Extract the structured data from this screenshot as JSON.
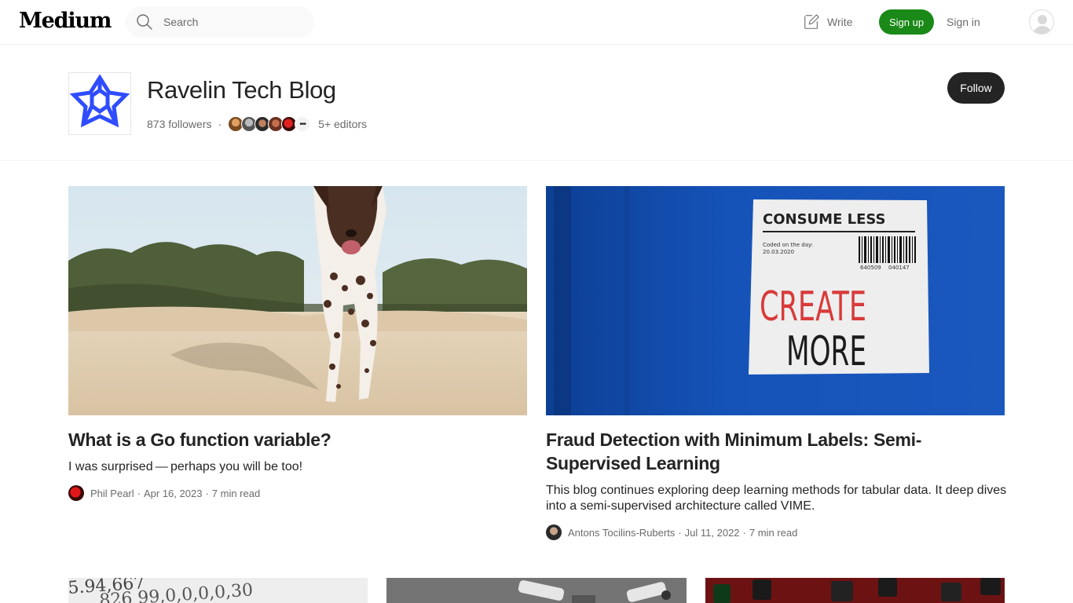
{
  "nav": {
    "logo": "Medium",
    "search_placeholder": "Search",
    "write_label": "Write",
    "signup_label": "Sign up",
    "signin_label": "Sign in"
  },
  "publication": {
    "name": "Ravelin Tech Blog",
    "followers": "873 followers",
    "editors": "5+ editors",
    "follow_label": "Follow"
  },
  "featured": [
    {
      "title": "What is a Go function variable?",
      "subtitle": "I was surprised — perhaps you will be too!",
      "author": "Phil Pearl",
      "date": "Apr 16, 2023",
      "read_time": "7 min read"
    },
    {
      "title": "Fraud Detection with Minimum Labels: Semi-Supervised Learning",
      "subtitle": "This blog continues exploring deep learning methods for tabular data. It deep dives into a semi-supervised architecture called VIME.",
      "author": "Antons Tocilins-Ruberts",
      "date": "Jul 11, 2022",
      "read_time": "7 min read",
      "image_text": {
        "heading": "CONSUME LESS",
        "coded_label": "Coded on the day:",
        "coded_date": "20.03.2020",
        "barcode_a": "640509",
        "barcode_b": "040147",
        "line1": "CREATE",
        "line2": "MORE"
      }
    }
  ],
  "bottom_row": {
    "first_image_text": "5.94,667",
    "first_image_text_2": "826 99,0,0,0,0,30"
  },
  "colors": {
    "brand_green": "#1a8917",
    "dark_button": "#242424",
    "text_primary": "#242424",
    "text_secondary": "#6b6b6b",
    "ravelin_blue": "#2f4cff"
  }
}
